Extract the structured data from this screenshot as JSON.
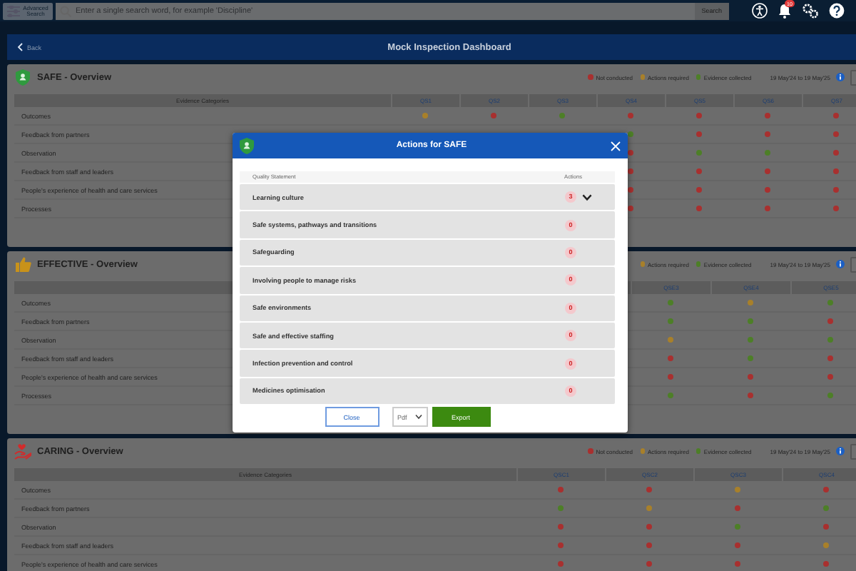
{
  "topbar": {
    "advanced_search": "Advanced Search",
    "search": {
      "placeholder": "Enter a single search word, for example 'Discipline'"
    },
    "search_button": "Search",
    "notification_count": "10"
  },
  "dashboard": {
    "back": "Back",
    "title": "Mock Inspection Dashboard"
  },
  "sections": [
    {
      "title": "SAFE - Overview",
      "legend": [
        {
          "color": "#a8302f",
          "label": "Not conducted"
        },
        {
          "color": "#a8802a",
          "label": "Actions required"
        },
        {
          "color": "#4d7f27",
          "label": "Evidence collected"
        }
      ],
      "date_range": "19 May'24 to 19 May'25",
      "evidence_heading": "Evidence Categories",
      "columns": [
        "QS1",
        "QS2",
        "QS3",
        "QS4",
        "QS5",
        "QS6",
        "QS7"
      ],
      "rows": [
        {
          "category": "Outcomes",
          "cells": [
            {
              "color": "#a8802a"
            },
            {
              "color": "#a8302f"
            },
            {
              "color": "#4d7f27"
            },
            {
              "color": "#a8302f"
            },
            {
              "color": "#a8302f"
            },
            {
              "color": "#a8302f"
            },
            {
              "color": "#a8302f"
            }
          ]
        },
        {
          "category": "Feedback from partners",
          "cells": [
            null,
            null,
            null,
            {
              "color": "#4d7f27"
            },
            {
              "color": "#a8302f"
            },
            {
              "color": "#a8302f"
            },
            {
              "color": "#a8302f"
            }
          ]
        },
        {
          "category": "Observation",
          "cells": [
            null,
            null,
            null,
            {
              "color": "#a8302f"
            },
            {
              "color": "#4d7f27"
            },
            {
              "color": "#4d7f27"
            },
            {
              "color": "#a8302f"
            }
          ]
        },
        {
          "category": "Feedback from staff and leaders",
          "cells": [
            null,
            null,
            null,
            {
              "color": "#a8302f"
            },
            {
              "color": "#a8302f"
            },
            {
              "color": "#a8302f"
            },
            {
              "color": "#a8302f"
            }
          ]
        },
        {
          "category": "People's experience of health and care services",
          "cells": [
            null,
            null,
            null,
            {
              "color": "#a8302f"
            },
            {
              "color": "#a8302f"
            },
            {
              "color": "#a8302f"
            },
            {
              "color": "#a8302f"
            }
          ]
        },
        {
          "category": "Processes",
          "cells": [
            null,
            null,
            null,
            {
              "color": "#a8302f"
            },
            {
              "color": "#a8302f"
            },
            {
              "color": "#a8302f"
            },
            {
              "color": "#a8302f"
            }
          ]
        }
      ]
    },
    {
      "title": "EFFECTIVE - Overview",
      "legend": [
        {
          "color": "#a8802a",
          "label": "Actions required"
        },
        {
          "color": "#4d7f27",
          "label": "Evidence collected"
        }
      ],
      "date_range": "19 May'24 to 19 May'25",
      "columns": [
        "QSE3",
        "QSE4",
        "QSE5"
      ],
      "rows": [
        {
          "category": "Outcomes",
          "cells": [
            {
              "color": "#4d7f27"
            },
            {
              "color": "#a8802a"
            },
            {
              "color": "#4d7f27"
            }
          ]
        },
        {
          "category": "Feedback from partners",
          "cells": [
            {
              "color": "#4d7f27"
            },
            {
              "color": "#4d7f27"
            },
            {
              "color": "#a8302f"
            }
          ]
        },
        {
          "category": "Observation",
          "cells": [
            {
              "color": "#a8802a"
            },
            {
              "color": "#4d7f27"
            },
            {
              "color": "#4d7f27"
            }
          ]
        },
        {
          "category": "Feedback from staff and leaders",
          "cells": [
            {
              "color": "#a8302f"
            },
            {
              "color": "#4d7f27"
            },
            {
              "color": "#a8302f"
            }
          ]
        },
        {
          "category": "People's experience of health and care services",
          "cells": [
            {
              "color": "#a8302f"
            },
            {
              "color": "#a8302f"
            },
            {
              "color": "#a8302f"
            }
          ]
        },
        {
          "category": "Processes",
          "cells": [
            {
              "color": "#4d7f27"
            },
            {
              "color": "#a8302f"
            },
            {
              "color": "#4d7f27"
            }
          ]
        }
      ]
    },
    {
      "title": "CARING - Overview",
      "legend": [
        {
          "color": "#a8302f",
          "label": "Not conducted"
        },
        {
          "color": "#a8802a",
          "label": "Actions required"
        },
        {
          "color": "#4d7f27",
          "label": "Evidence collected"
        }
      ],
      "date_range": "19 May'24 to 19 May'25",
      "evidence_heading": "Evidence Categories",
      "columns": [
        "QSC1",
        "QSC2",
        "QSC3",
        "QSC4"
      ],
      "rows": [
        {
          "category": "Outcomes",
          "cells": [
            {
              "color": "#a8302f"
            },
            {
              "color": "#a8302f"
            },
            {
              "color": "#a8802a"
            },
            {
              "color": "#a8302f"
            }
          ]
        },
        {
          "category": "Feedback from partners",
          "cells": [
            {
              "color": "#4d7f27"
            },
            {
              "color": "#a8802a"
            },
            {
              "color": "#a8302f"
            },
            {
              "color": "#4d7f27"
            }
          ]
        },
        {
          "category": "Observation",
          "cells": [
            {
              "color": "#a8302f"
            },
            {
              "color": "#a8302f"
            },
            {
              "color": "#4d7f27"
            },
            {
              "color": "#a8302f"
            }
          ]
        },
        {
          "category": "Feedback from staff and leaders",
          "cells": [
            {
              "color": "#a8302f"
            },
            {
              "color": "#a8302f"
            },
            {
              "color": "#a8302f"
            },
            {
              "color": "#a8802a"
            }
          ]
        },
        {
          "category": "People's experience of health and care services",
          "cells": [
            {
              "color": "#a8302f"
            },
            {
              "color": "#a8302f"
            },
            {
              "color": "#a8302f"
            },
            {
              "color": "#a8302f"
            }
          ]
        }
      ]
    }
  ],
  "modal": {
    "title": "Actions for SAFE",
    "statement_heading": "Quality Statement",
    "actions_heading": "Actions",
    "rows": [
      {
        "statement": "Learning culture",
        "actions": "3",
        "expandable": true
      },
      {
        "statement": "Safe systems, pathways and transitions",
        "actions": "0",
        "expandable": false
      },
      {
        "statement": "Safeguarding",
        "actions": "0",
        "expandable": false
      },
      {
        "statement": "Involving people to manage risks",
        "actions": "0",
        "expandable": false
      },
      {
        "statement": "Safe environments",
        "actions": "0",
        "expandable": false
      },
      {
        "statement": "Safe and effective staffing",
        "actions": "0",
        "expandable": false
      },
      {
        "statement": "Infection prevention and control",
        "actions": "0",
        "expandable": false
      },
      {
        "statement": "Medicines optimisation",
        "actions": "0",
        "expandable": false
      }
    ],
    "close_button": "Close",
    "format": "Pdf",
    "export_button": "Export"
  }
}
